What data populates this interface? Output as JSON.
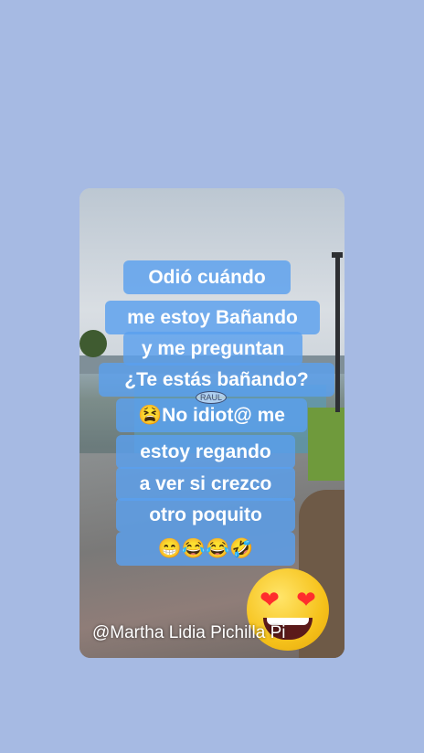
{
  "lines": [
    "Odió cuándo",
    "me estoy Bañando",
    "y me preguntan",
    "¿Te estás bañando?",
    "😫No idiot@ me",
    "estoy regando",
    "a ver si crezco",
    "otro poquito",
    "😁😂😂🤣"
  ],
  "sign_text": "RAUL",
  "emoji": {
    "eyes": "❤"
  },
  "watermark": "@Martha Lidia Pichilla Pi",
  "colors": {
    "background": "#a6bae3",
    "text_bar": "#5aa0ee"
  }
}
